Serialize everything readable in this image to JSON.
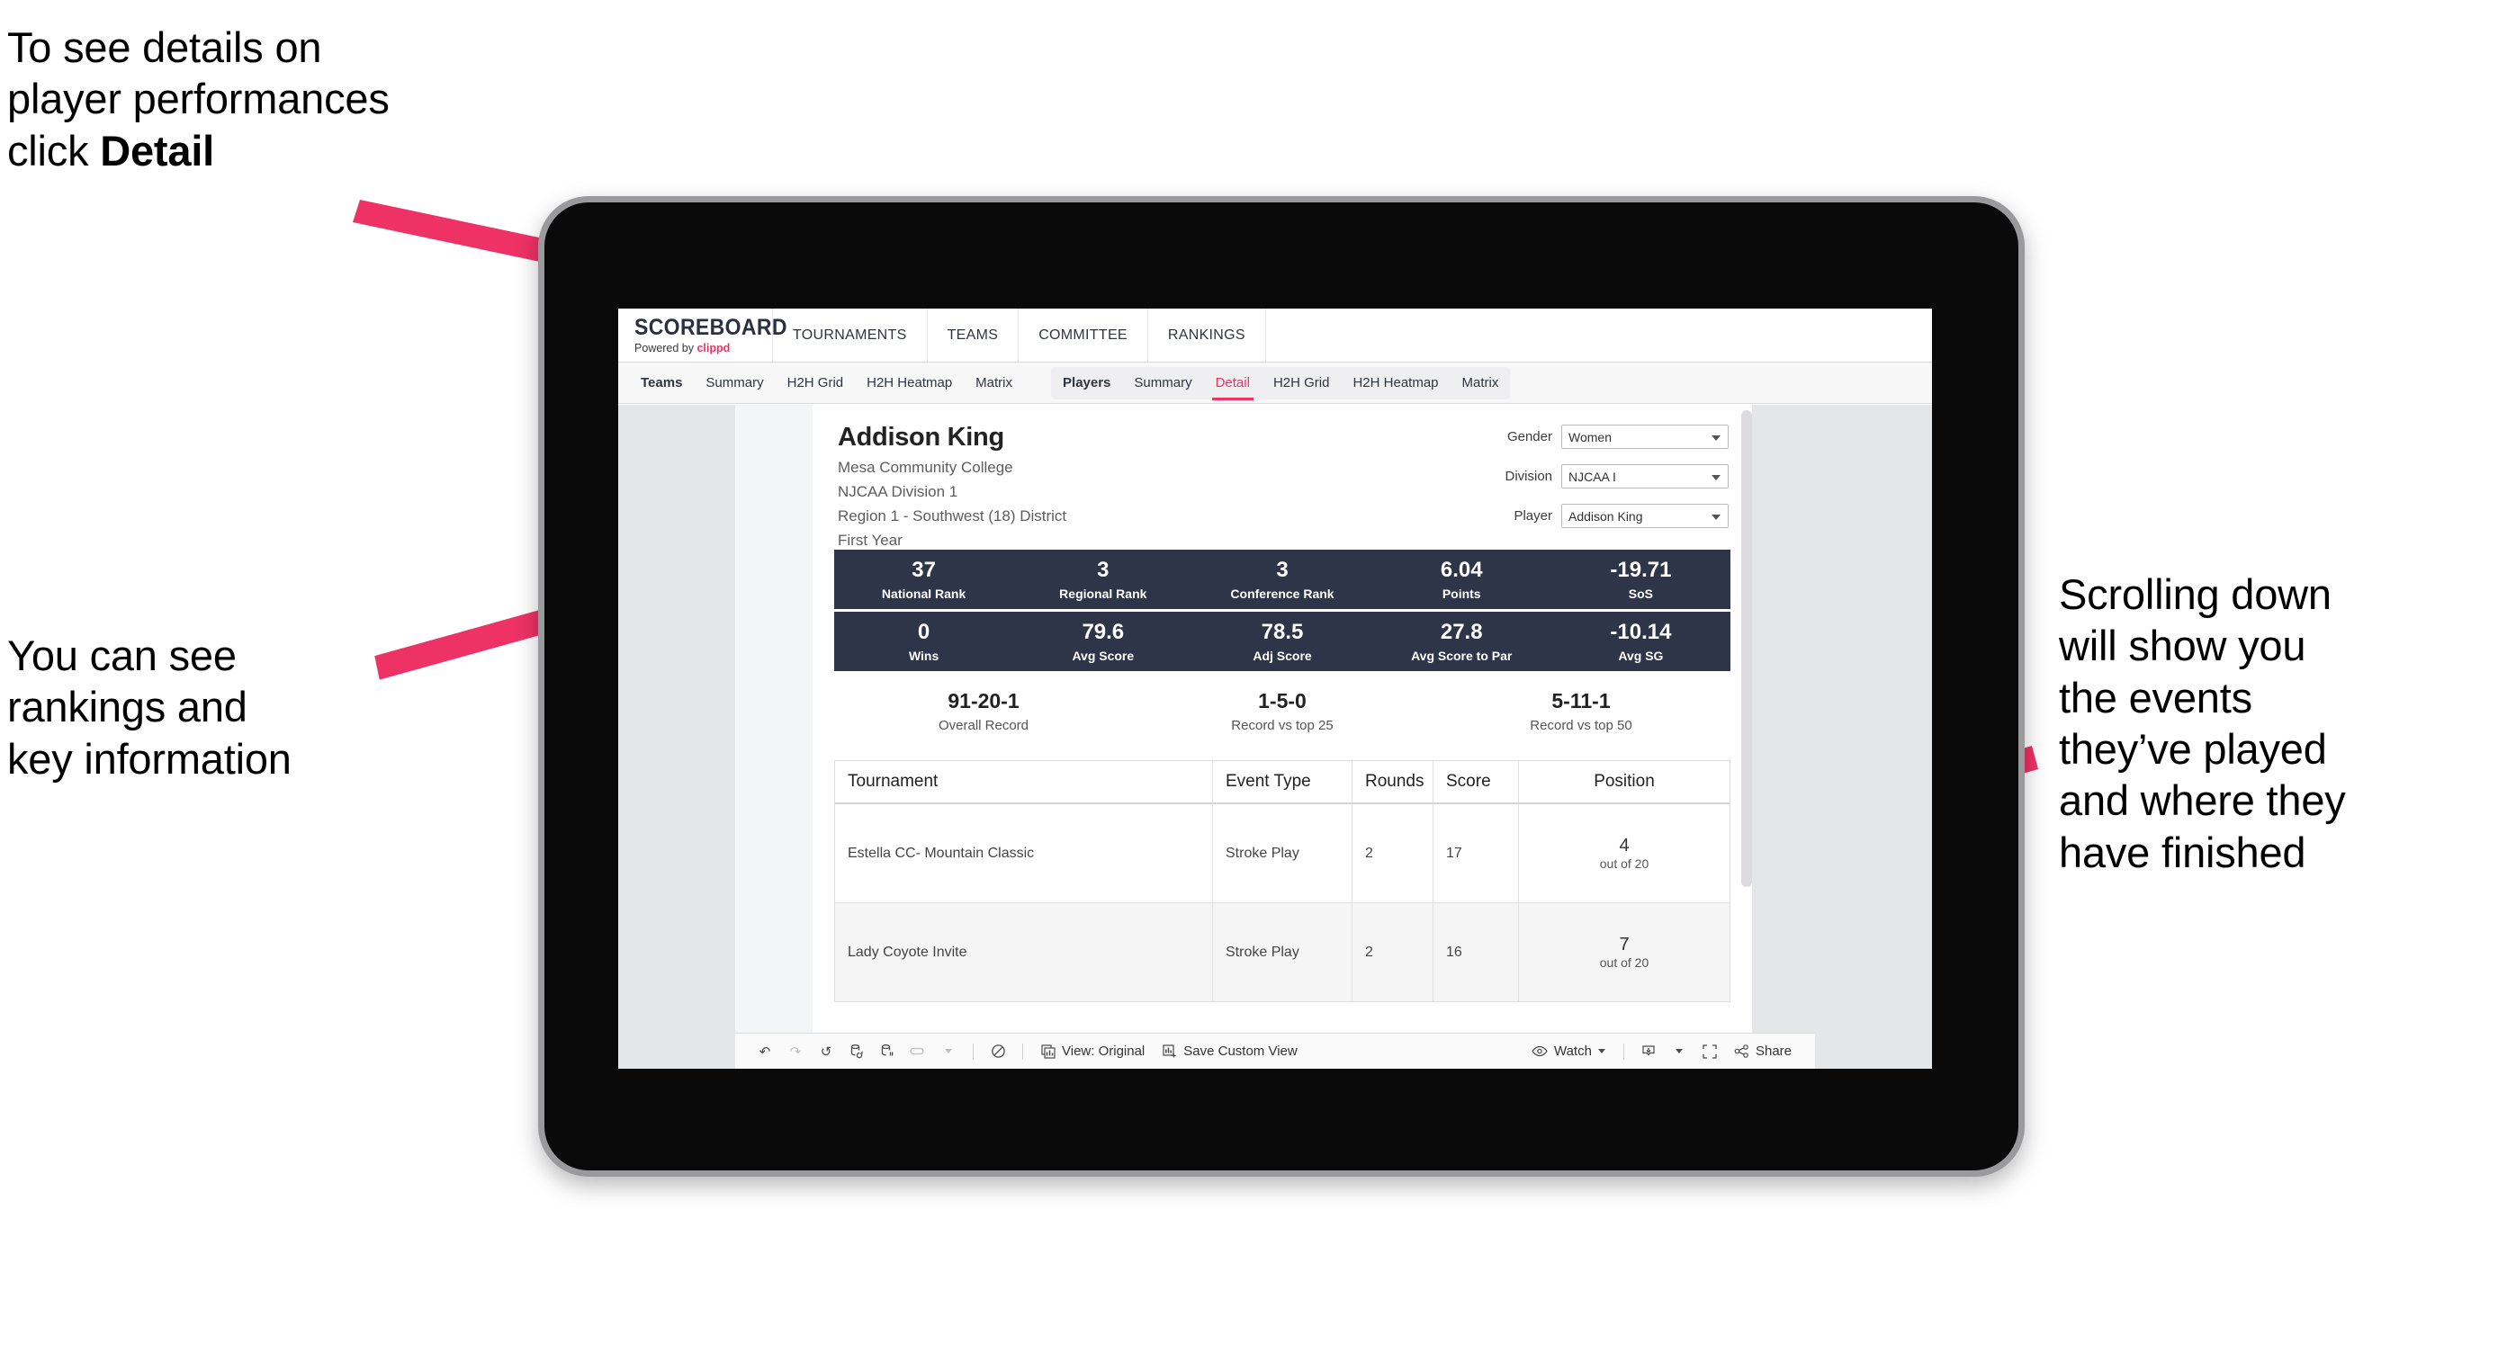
{
  "annotations": {
    "top_left": {
      "line1": "To see details on",
      "line2": "player performances",
      "line3_pre": "click ",
      "line3_bold": "Detail"
    },
    "mid_left": {
      "line1": "You can see",
      "line2": "rankings and",
      "line3": "key information"
    },
    "right": {
      "line1": "Scrolling down",
      "line2": "will show you",
      "line3": "the events",
      "line4": "they’ve played",
      "line5": "and where they",
      "line6": "have finished"
    },
    "arrow_color": "#ee3265"
  },
  "app": {
    "logo": {
      "word": "SCOREBOARD",
      "powered_prefix": "Powered by ",
      "brand": "clippd"
    },
    "topnav": [
      {
        "label": "TOURNAMENTS"
      },
      {
        "label": "TEAMS"
      },
      {
        "label": "COMMITTEE"
      },
      {
        "label": "RANKINGS"
      }
    ],
    "subnav": {
      "teams_group": {
        "label": "Teams",
        "items": [
          "Summary",
          "H2H Grid",
          "H2H Heatmap",
          "Matrix"
        ]
      },
      "players_group": {
        "label": "Players",
        "items": [
          "Summary",
          "Detail",
          "H2H Grid",
          "H2H Heatmap",
          "Matrix"
        ],
        "active": "Detail"
      }
    }
  },
  "player": {
    "name": "Addison King",
    "school": "Mesa Community College",
    "division": "NJCAA Division 1",
    "region": "Region 1 - Southwest (18) District",
    "year": "First Year"
  },
  "filters": [
    {
      "label": "Gender",
      "value": "Women"
    },
    {
      "label": "Division",
      "value": "NJCAA I"
    },
    {
      "label": "Player",
      "value": "Addison King"
    }
  ],
  "stats_band_1": [
    {
      "value": "37",
      "label": "National Rank"
    },
    {
      "value": "3",
      "label": "Regional Rank"
    },
    {
      "value": "3",
      "label": "Conference Rank"
    },
    {
      "value": "6.04",
      "label": "Points"
    },
    {
      "value": "-19.71",
      "label": "SoS"
    }
  ],
  "stats_band_2": [
    {
      "value": "0",
      "label": "Wins"
    },
    {
      "value": "79.6",
      "label": "Avg Score"
    },
    {
      "value": "78.5",
      "label": "Adj Score"
    },
    {
      "value": "27.8",
      "label": "Avg Score to Par"
    },
    {
      "value": "-10.14",
      "label": "Avg SG"
    }
  ],
  "records": [
    {
      "value": "91-20-1",
      "label": "Overall Record"
    },
    {
      "value": "1-5-0",
      "label": "Record vs top 25"
    },
    {
      "value": "5-11-1",
      "label": "Record vs top 50"
    }
  ],
  "events_table": {
    "columns": [
      "Tournament",
      "Event Type",
      "Rounds",
      "Score",
      "Position"
    ],
    "rows": [
      {
        "tournament": "Estella CC- Mountain Classic",
        "event_type": "Stroke Play",
        "rounds": "2",
        "score": "17",
        "position": "4",
        "position_sub": "out of 20"
      },
      {
        "tournament": "Lady Coyote Invite",
        "event_type": "Stroke Play",
        "rounds": "2",
        "score": "16",
        "position": "7",
        "position_sub": "out of 20"
      }
    ]
  },
  "toolbar": {
    "view_label": "View: Original",
    "save_label": "Save Custom View",
    "watch_label": "Watch",
    "share_label": "Share"
  },
  "colors": {
    "accent": "#ee3265",
    "band": "#2f3549",
    "canvas": "#e4e6e8"
  }
}
